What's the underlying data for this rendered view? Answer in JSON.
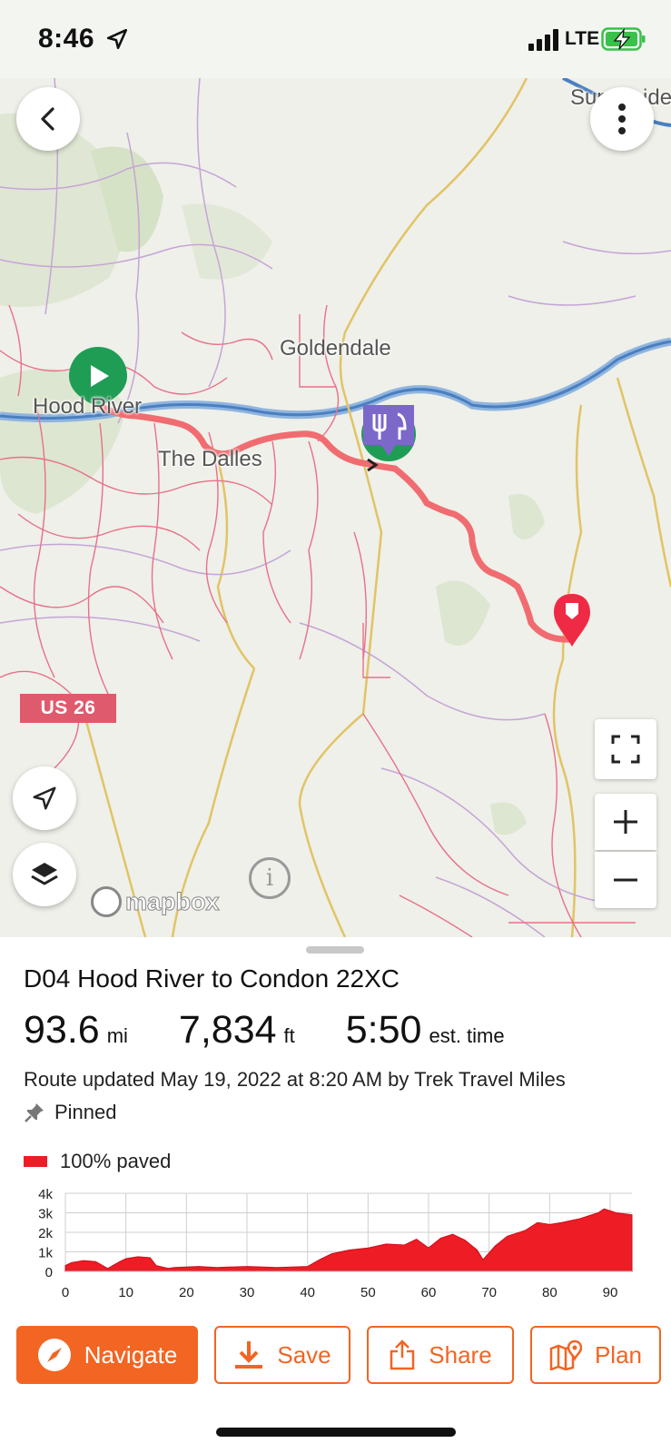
{
  "status_bar": {
    "time": "8:46",
    "network": "LTE"
  },
  "map": {
    "labels": {
      "goldendale": "Goldendale",
      "hood_river": "Hood River",
      "the_dalles": "The Dalles",
      "sunnyside": "Sunnyside"
    },
    "highway_shield": "US 26",
    "attribution": "mapbox",
    "info_symbol": "i",
    "route_color": "#f06c70",
    "start_marker_color": "#1f9d55",
    "food_marker_color": "#7b68c9",
    "end_marker_color": "#ee2a45"
  },
  "route": {
    "title": "D04 Hood River to Condon 22XC",
    "distance_value": "93.6",
    "distance_unit": "mi",
    "elevation_value": "7,834",
    "elevation_unit": "ft",
    "time_value": "5:50",
    "time_unit": "est. time",
    "updated": "Route updated May 19, 2022 at 8:20 AM by Trek Travel Miles",
    "pinned_label": "Pinned",
    "surface_label": "100% paved",
    "surface_color": "#ee1c25"
  },
  "chart_data": {
    "type": "area",
    "title": "",
    "xlabel": "",
    "ylabel": "",
    "x_ticks": [
      0,
      10,
      20,
      30,
      40,
      50,
      60,
      70,
      80,
      90
    ],
    "y_ticks": [
      "0",
      "1k",
      "2k",
      "3k",
      "4k"
    ],
    "xlim": [
      0,
      93.6
    ],
    "ylim": [
      0,
      4000
    ],
    "grid": true,
    "fill_color": "#ee1c25",
    "x": [
      0,
      1,
      3,
      5,
      7,
      9,
      10,
      12,
      14,
      15,
      17,
      18,
      22,
      25,
      30,
      35,
      40,
      42,
      44,
      47,
      50,
      53,
      56,
      58,
      60,
      62,
      64,
      66,
      68,
      69,
      71,
      73,
      76,
      78,
      80,
      82,
      85,
      88,
      89,
      91,
      93.6
    ],
    "y": [
      300,
      450,
      550,
      500,
      150,
      500,
      650,
      750,
      700,
      300,
      150,
      200,
      250,
      200,
      250,
      200,
      250,
      600,
      900,
      1100,
      1200,
      1400,
      1350,
      1650,
      1200,
      1700,
      1900,
      1600,
      1100,
      600,
      1300,
      1800,
      2100,
      2500,
      2400,
      2500,
      2700,
      3000,
      3200,
      3000,
      2900
    ]
  },
  "actions": {
    "navigate": "Navigate",
    "save": "Save",
    "share": "Share",
    "plan": "Plan"
  }
}
